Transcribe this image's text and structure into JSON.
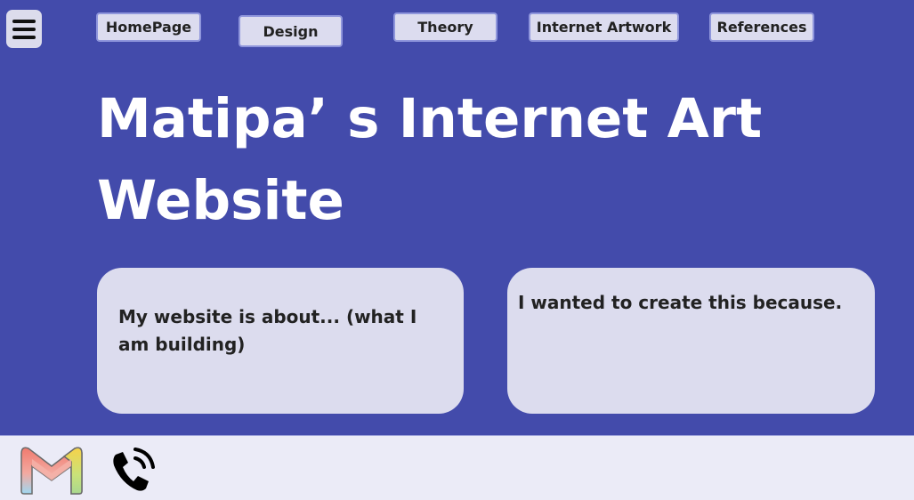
{
  "nav": {
    "menu_icon": "hamburger-menu-icon",
    "items": [
      {
        "label": "HomePage"
      },
      {
        "label": "Design"
      },
      {
        "label": "Theory"
      },
      {
        "label": "Internet Artwork"
      },
      {
        "label": "References"
      }
    ]
  },
  "main": {
    "title": "Matipa’ s Internet Art Website",
    "cards": [
      {
        "text": "My website is about... (what I am building)"
      },
      {
        "text": "I wanted to create this because."
      }
    ]
  },
  "footer": {
    "icons": [
      "gmail-icon",
      "phone-icon"
    ]
  },
  "colors": {
    "background": "#434bab",
    "nav_button": "#dcdcef",
    "card": "#dcdcee",
    "footer": "#ebebf7"
  }
}
